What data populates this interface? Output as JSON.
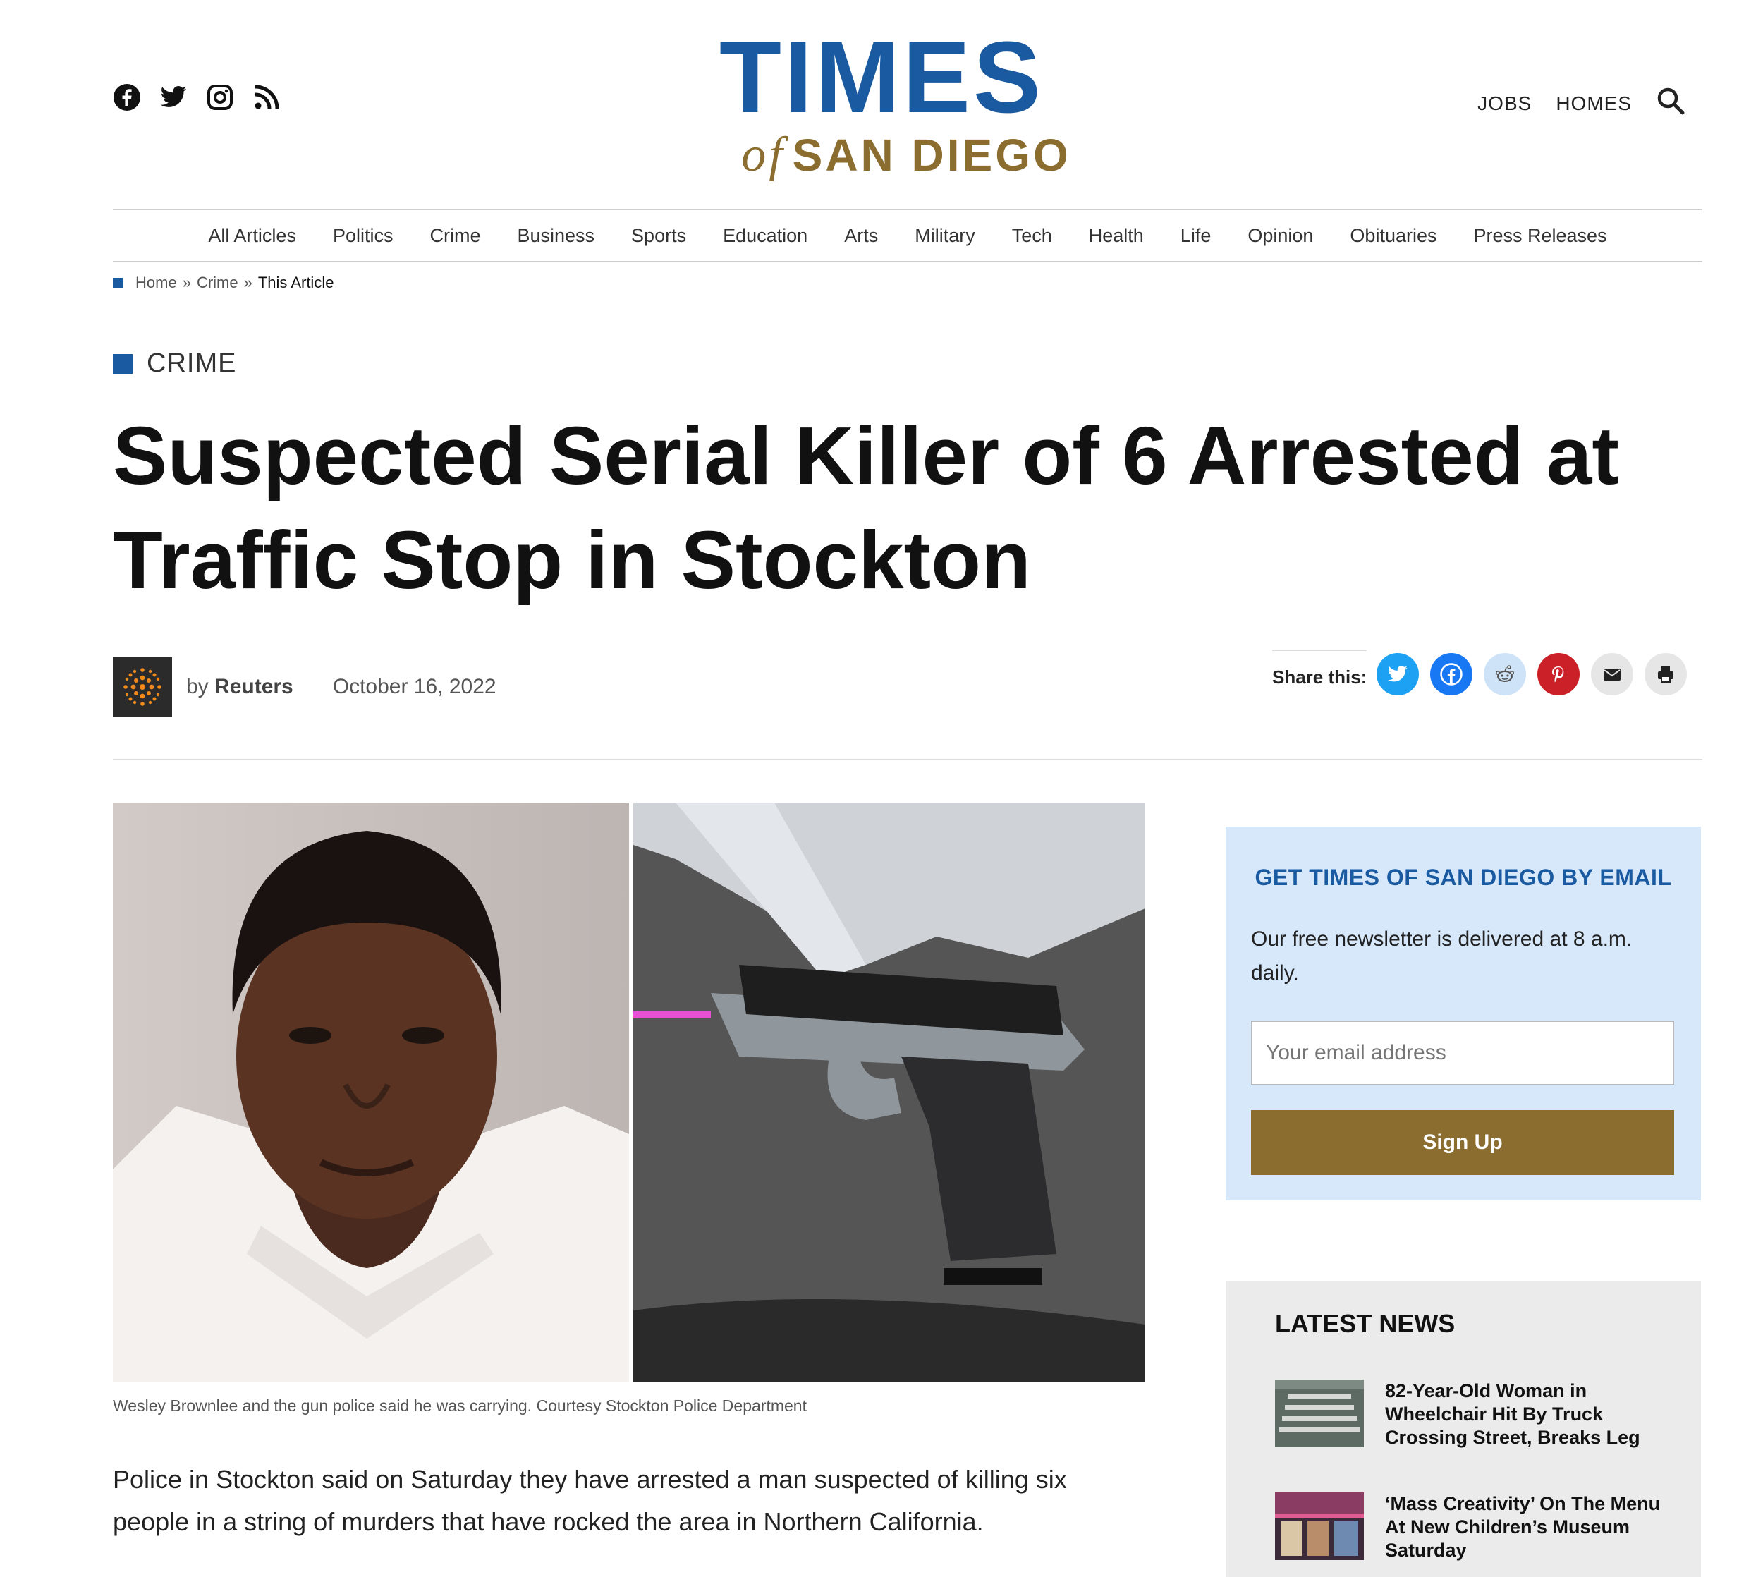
{
  "header": {
    "social_icons": [
      "facebook-icon",
      "twitter-icon",
      "instagram-icon",
      "rss-icon"
    ],
    "logo_line1": "TIMES",
    "logo_of": "of",
    "logo_line2": "SAN DIEGO",
    "links": [
      "JOBS",
      "HOMES"
    ],
    "search_icon": "search-icon"
  },
  "nav": {
    "items": [
      "All Articles",
      "Politics",
      "Crime",
      "Business",
      "Sports",
      "Education",
      "Arts",
      "Military",
      "Tech",
      "Health",
      "Life",
      "Opinion",
      "Obituaries",
      "Press Releases"
    ]
  },
  "breadcrumb": {
    "home": "Home",
    "sep": "»",
    "crime": "Crime",
    "current": "This Article"
  },
  "article": {
    "category": "CRIME",
    "headline": "Suspected Serial Killer of 6 Arrested at Traffic Stop in Stockton",
    "by": "by",
    "author": "Reuters",
    "date": "October 16, 2022",
    "caption": "Wesley Brownlee and the gun police said he was carrying. Courtesy Stockton Police Department",
    "paragraph": "Police in Stockton said on Saturday they have arrested a man suspected of killing six people in a string of murders that have rocked the area in Northern California."
  },
  "share": {
    "label": "Share this:",
    "buttons": [
      {
        "name": "share-twitter-button",
        "icon": "twitter-icon",
        "color": "#1da1f2"
      },
      {
        "name": "share-facebook-button",
        "icon": "facebook-icon",
        "color": "#1877f2"
      },
      {
        "name": "share-reddit-button",
        "icon": "reddit-icon",
        "color": "#cee3f8"
      },
      {
        "name": "share-pinterest-button",
        "icon": "pinterest-icon",
        "color": "#cb2027"
      },
      {
        "name": "share-email-button",
        "icon": "email-icon",
        "color": "#e6e6e6"
      },
      {
        "name": "share-print-button",
        "icon": "print-icon",
        "color": "#e6e6e6"
      }
    ]
  },
  "sidebar": {
    "newsletter": {
      "title": "GET TIMES OF SAN DIEGO BY EMAIL",
      "description": "Our free newsletter is delivered at 8 a.m. daily.",
      "email_placeholder": "Your email address",
      "button": "Sign Up"
    },
    "latest": {
      "title": "LATEST NEWS",
      "items": [
        {
          "title": "82-Year-Old Woman in Wheelchair Hit By Truck Crossing Street, Breaks Leg"
        },
        {
          "title": "‘Mass Creativity’ On The Menu At New Children’s Museum Saturday"
        }
      ]
    }
  },
  "colors": {
    "brand_blue": "#1a5aa0",
    "brand_gold": "#8a6d2f",
    "newsletter_bg": "#d7e8fb"
  }
}
